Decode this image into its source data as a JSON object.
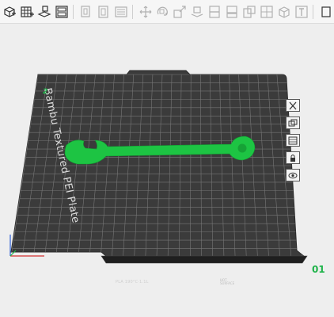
{
  "app": {
    "accent": "#1fb34a",
    "plate_color": "#3b3b3b",
    "grid_color": "#777777"
  },
  "toolbar": {
    "tools": [
      {
        "name": "add-cube-icon",
        "enabled": true
      },
      {
        "name": "grid-plate-icon",
        "enabled": true
      },
      {
        "name": "orient-icon",
        "enabled": true
      },
      {
        "name": "layout-icon",
        "enabled": true
      },
      {
        "name": "copy-icon",
        "enabled": false
      },
      {
        "name": "paste-icon",
        "enabled": false
      },
      {
        "name": "list-icon",
        "enabled": false
      },
      {
        "name": "move-icon",
        "enabled": false
      },
      {
        "name": "rotate-icon",
        "enabled": false
      },
      {
        "name": "scale-icon",
        "enabled": false
      },
      {
        "name": "lay-on-face-icon",
        "enabled": false
      },
      {
        "name": "cut-icon",
        "enabled": false
      },
      {
        "name": "support-paint-icon",
        "enabled": false
      },
      {
        "name": "seam-paint-icon",
        "enabled": false
      },
      {
        "name": "boolean-icon",
        "enabled": false
      },
      {
        "name": "text-icon",
        "enabled": false
      },
      {
        "name": "measure-icon",
        "enabled": false
      }
    ]
  },
  "plate": {
    "label": "Bambu Textured PEI Plate",
    "number": "01",
    "corner_mark": "2",
    "strip_text": "PLA 190°C·1.1L",
    "strip_right_line1": "HOT",
    "strip_right_line2": "SURFACE"
  },
  "plate_tools": [
    "close-icon",
    "arrange-icon",
    "slice-plate-icon",
    "lock-icon",
    "settings-eye-icon"
  ],
  "model": {
    "name": "wrench",
    "color": "#1dc443"
  }
}
